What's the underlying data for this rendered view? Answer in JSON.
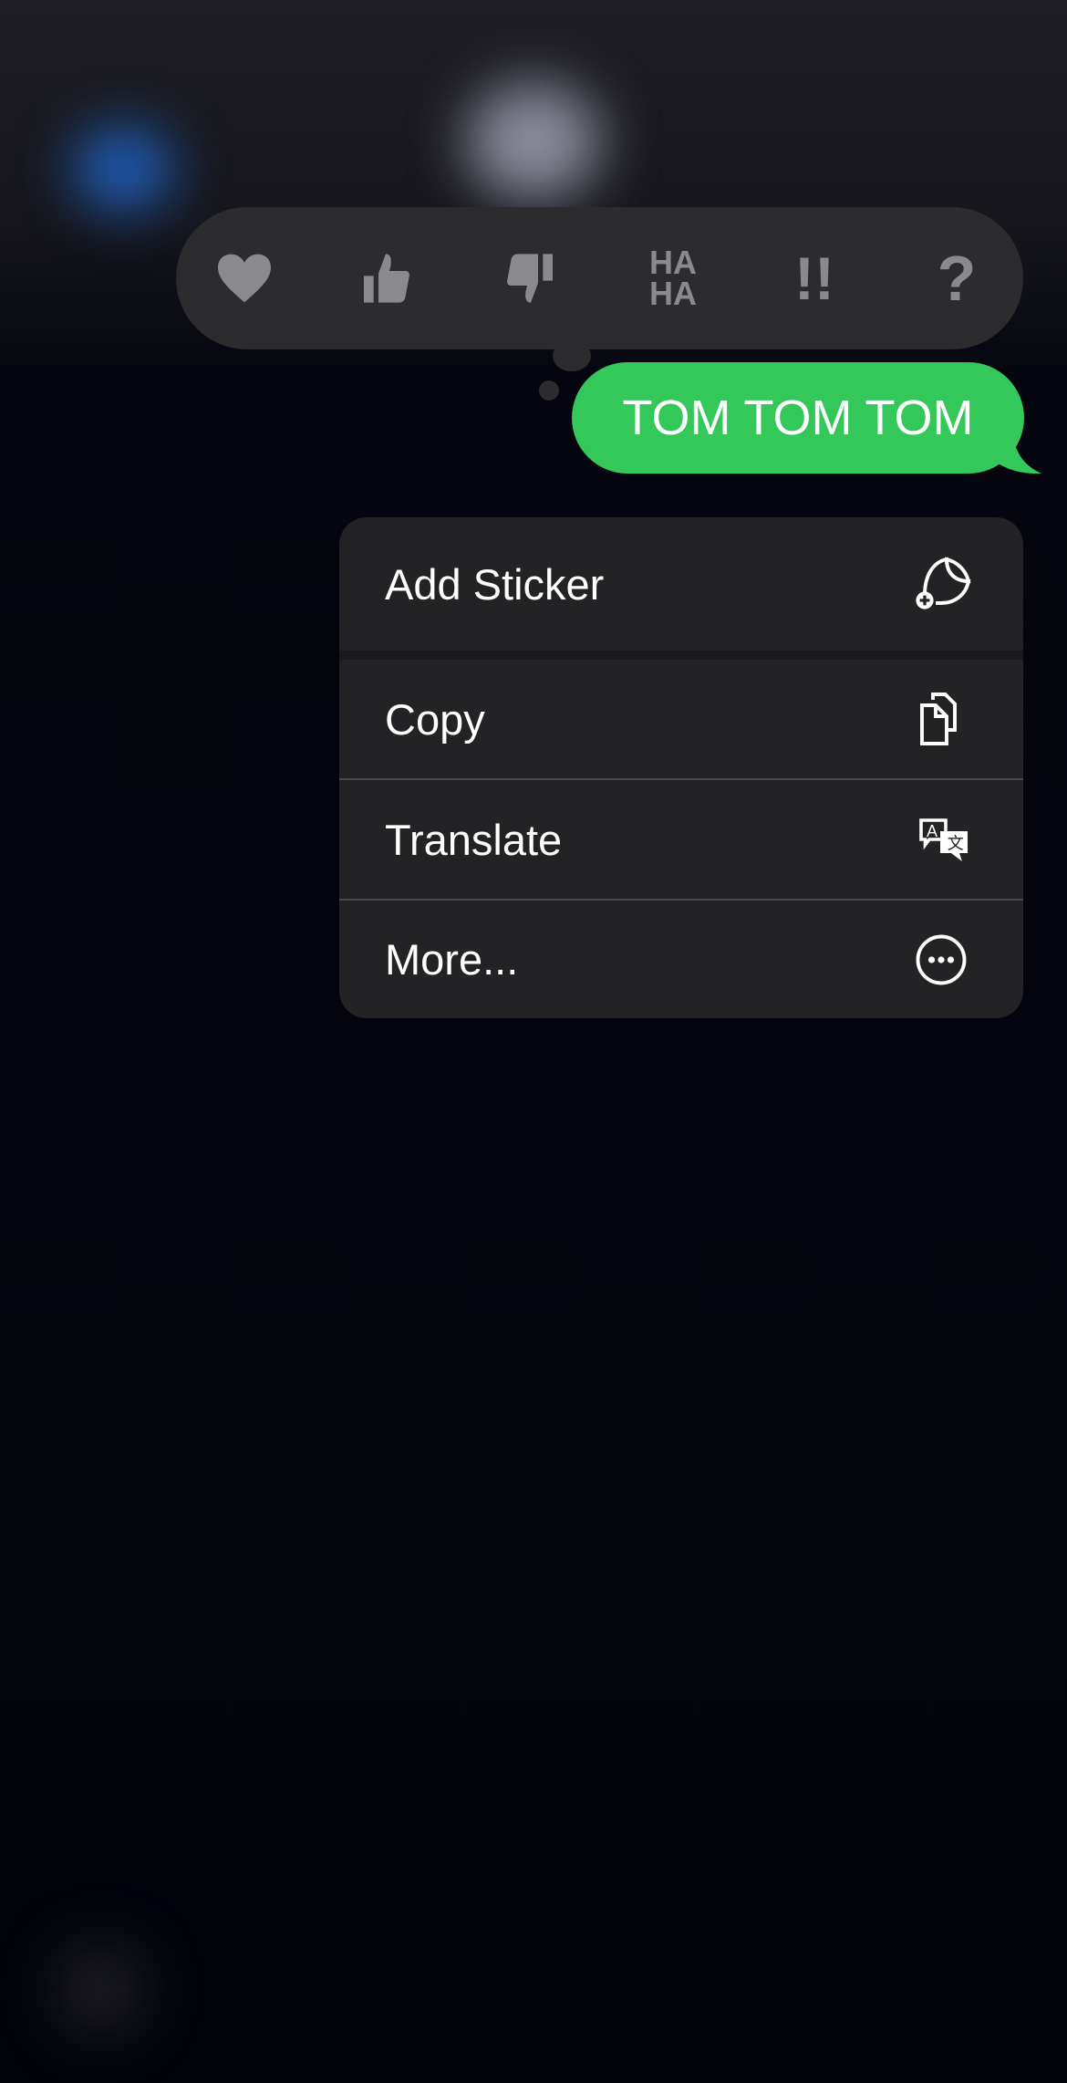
{
  "reactions": [
    {
      "name": "heart-icon",
      "label": "Heart"
    },
    {
      "name": "thumbs-up-icon",
      "label": "Like"
    },
    {
      "name": "thumbs-down-icon",
      "label": "Dislike"
    },
    {
      "name": "haha-icon",
      "label": "HA HA"
    },
    {
      "name": "exclamation-icon",
      "label": "!!"
    },
    {
      "name": "question-icon",
      "label": "?"
    }
  ],
  "message": {
    "text": "TOM TOM TOM",
    "color": "#34c759"
  },
  "menu": {
    "items": [
      {
        "label": "Add Sticker",
        "icon": "add-sticker-icon"
      },
      {
        "label": "Copy",
        "icon": "copy-icon"
      },
      {
        "label": "Translate",
        "icon": "translate-icon"
      },
      {
        "label": "More...",
        "icon": "more-icon"
      }
    ]
  }
}
